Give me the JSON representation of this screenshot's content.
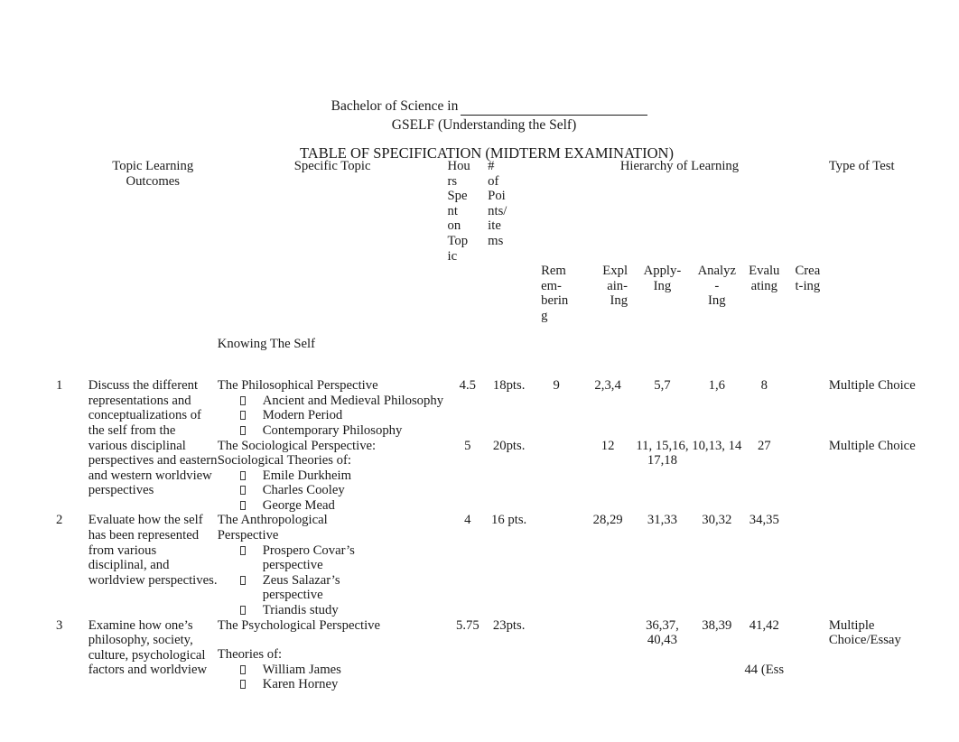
{
  "document": {
    "header": {
      "degree_line": "Bachelor of Science in",
      "degree_blank": "__________________________",
      "course_line": "GSELF (Understanding the Self)",
      "table_title": "TABLE OF SPECIFICATION (MIDTERM EXAMINATION)"
    },
    "table": {
      "headers": {
        "topic_learning_outcomes": "Topic Learning\nOutcomes",
        "specific_topic": "Specific Topic",
        "hours_spent_on_topic": "Hou\nrs\nSpe\nnt\non\nTop\nic",
        "number_of_points_items": "#\nof\nPoi\nnts/\nite\nms",
        "hierarchy_of_learning": "Hierarchy of Learning",
        "type_of_test": "Type of Test"
      },
      "sub_headers": {
        "remembering": "Rem\nem-\nberin\ng",
        "explaining": "Expl\nain-\nIng",
        "applying": "Apply-\nIng",
        "analyzing": "Analyz\n-\nIng",
        "evaluating": "Evalu\nating",
        "creating": "Crea\nt-ing"
      },
      "section_label": "Knowing The Self",
      "rows": [
        {
          "number": "1",
          "tlo": "Discuss the different representations and conceptualizations of the self from the various disciplinal perspectives and eastern and western worldview perspectives",
          "topic_title": "The Philosophical Perspective",
          "topic_subtitle": "",
          "bullets": [
            "Ancient and Medieval Philosophy",
            "Modern Period",
            "Contemporary Philosophy"
          ],
          "hours": "4.5",
          "points": "18pts.",
          "remembering": "9",
          "explaining": "2,3,4",
          "applying": "5,7",
          "analyzing": "1,6",
          "evaluating": "8",
          "creating": "",
          "type_of_test": "Multiple Choice"
        },
        {
          "number": "",
          "tlo": "",
          "topic_title": "The Sociological Perspective:",
          "topic_subtitle": "Sociological Theories of:",
          "bullets": [
            "Emile Durkheim",
            "Charles Cooley",
            "George Mead"
          ],
          "hours": "5",
          "points": "20pts.",
          "remembering": "",
          "explaining": "12",
          "applying": "11, 15,16, 17,18",
          "analyzing": "10,13, 14",
          "evaluating": "27",
          "creating": "",
          "type_of_test": "Multiple Choice"
        },
        {
          "number": "2",
          "tlo": "Evaluate how the self has been represented from various disciplinal, and worldview perspectives.",
          "topic_title": "The Anthropological Perspective",
          "topic_subtitle": "",
          "bullets": [
            "Prospero Covar’s perspective",
            "Zeus Salazar’s perspective",
            "Triandis study"
          ],
          "hours": "4",
          "points": "16 pts.",
          "remembering": "",
          "explaining": "28,29",
          "applying": "31,33",
          "analyzing": "30,32",
          "evaluating": "34,35",
          "creating": "",
          "type_of_test": ""
        },
        {
          "number": "3",
          "tlo": "Examine how one’s philosophy, society, culture, psychological factors and worldview",
          "topic_title": "The Psychological Perspective",
          "topic_subtitle": "Theories of:",
          "bullets": [
            "William James",
            "Karen Horney"
          ],
          "hours": "5.75",
          "points": "23pts.",
          "remembering": "",
          "explaining": "",
          "applying": "36,37, 40,43",
          "analyzing": "38,39",
          "evaluating": "41,42",
          "evaluating_extra": "44 (Ess",
          "creating": "",
          "type_of_test": "Multiple Choice/Essay"
        }
      ]
    }
  }
}
